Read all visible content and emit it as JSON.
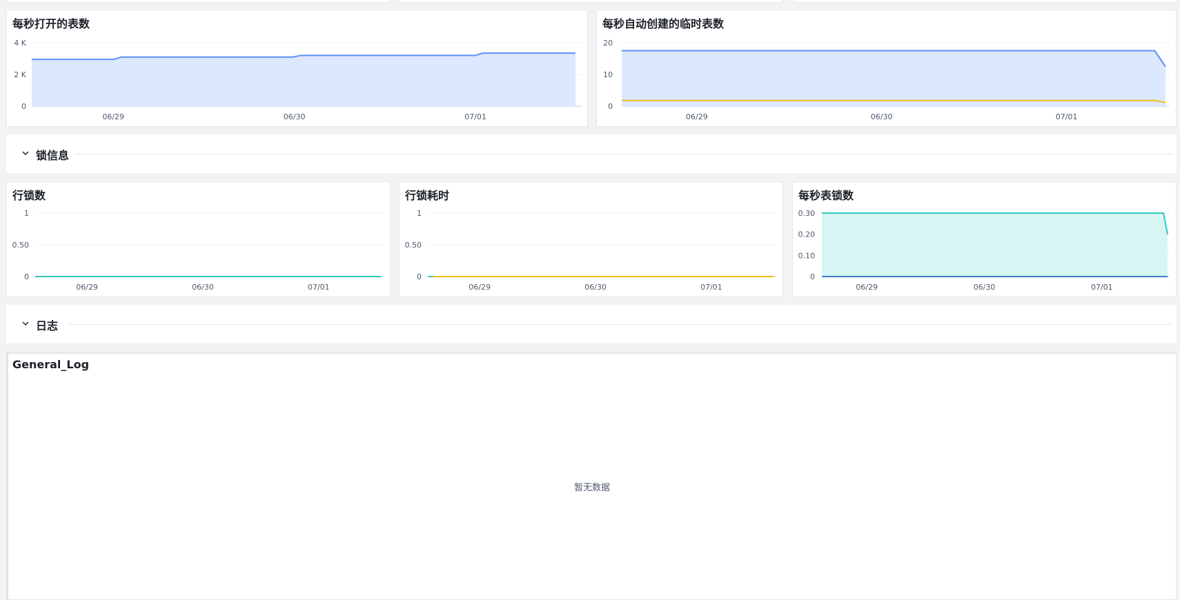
{
  "sections": {
    "lock_info": "锁信息",
    "logs": "日志"
  },
  "general_log": {
    "title": "General_Log",
    "empty_text": "暂无数据"
  },
  "colors": {
    "blue": "#5b8ff9",
    "blue_fill": "#dce8fe",
    "orange": "#f6bd16",
    "teal": "#2ec7c0",
    "teal_fill": "#d7f5f3",
    "dark_blue": "#3a7bd5"
  },
  "chart_data": [
    {
      "id": "open_tables",
      "type": "area",
      "title": "每秒打开的表数",
      "x_ticks": [
        "06/29",
        "06/30",
        "07/01"
      ],
      "y_ticks": [
        "0",
        "2 K",
        "4 K"
      ],
      "ylim": [
        0,
        4000
      ],
      "x_range": [
        0,
        100
      ],
      "x_tick_positions": [
        15,
        48.3,
        81.6
      ],
      "series": [
        {
          "color": "blue",
          "fill": "blue_fill",
          "x": [
            0,
            15,
            16.5,
            48,
            49.5,
            81.5,
            83,
            100
          ],
          "values": [
            2950,
            2950,
            3100,
            3100,
            3200,
            3200,
            3350,
            3350
          ]
        }
      ]
    },
    {
      "id": "auto_tmp_tables",
      "type": "area",
      "title": "每秒自动创建的临时表数",
      "x_ticks": [
        "06/29",
        "06/30",
        "07/01"
      ],
      "y_ticks": [
        "0",
        "10",
        "20"
      ],
      "ylim": [
        0,
        20
      ],
      "x_range": [
        0,
        100
      ],
      "x_tick_positions": [
        13.8,
        47.8,
        81.8
      ],
      "series": [
        {
          "color": "blue",
          "fill": "blue_fill",
          "x": [
            0,
            98,
            100
          ],
          "values": [
            17.5,
            17.5,
            12.5
          ]
        },
        {
          "color": "orange",
          "fill": "",
          "x": [
            0,
            98,
            100
          ],
          "values": [
            1.8,
            1.8,
            1.2
          ]
        }
      ]
    },
    {
      "id": "row_locks",
      "type": "line",
      "title": "行锁数",
      "x_ticks": [
        "06/29",
        "06/30",
        "07/01"
      ],
      "y_ticks": [
        "0",
        "0.50",
        "1"
      ],
      "ylim": [
        0,
        1
      ],
      "x_range": [
        0,
        100
      ],
      "x_tick_positions": [
        15,
        48.5,
        82
      ],
      "series": [
        {
          "color": "teal",
          "fill": "",
          "x": [
            0,
            100
          ],
          "values": [
            0,
            0
          ]
        }
      ]
    },
    {
      "id": "row_lock_time",
      "type": "line",
      "title": "行锁耗时",
      "x_ticks": [
        "06/29",
        "06/30",
        "07/01"
      ],
      "y_ticks": [
        "0",
        "0.50",
        "1"
      ],
      "ylim": [
        0,
        1
      ],
      "x_range": [
        0,
        100
      ],
      "x_tick_positions": [
        15,
        48.5,
        82
      ],
      "series": [
        {
          "color": "orange",
          "fill": "",
          "x": [
            1.5,
            100
          ],
          "values": [
            0,
            0
          ]
        },
        {
          "color": "teal",
          "fill": "",
          "x": [
            0,
            1.5
          ],
          "values": [
            0,
            0
          ]
        }
      ]
    },
    {
      "id": "table_locks",
      "type": "area",
      "title": "每秒表锁数",
      "x_ticks": [
        "06/29",
        "06/30",
        "07/01"
      ],
      "y_ticks": [
        "0",
        "0.10",
        "0.20",
        "0.30"
      ],
      "ylim": [
        0,
        0.3
      ],
      "x_range": [
        0,
        100
      ],
      "x_tick_positions": [
        13,
        47,
        81
      ],
      "series": [
        {
          "color": "teal",
          "fill": "teal_fill",
          "x": [
            0,
            98.8,
            100
          ],
          "values": [
            0.3,
            0.3,
            0.2
          ]
        },
        {
          "color": "dark_blue",
          "fill": "",
          "x": [
            0,
            100
          ],
          "values": [
            0,
            0
          ]
        }
      ]
    }
  ]
}
